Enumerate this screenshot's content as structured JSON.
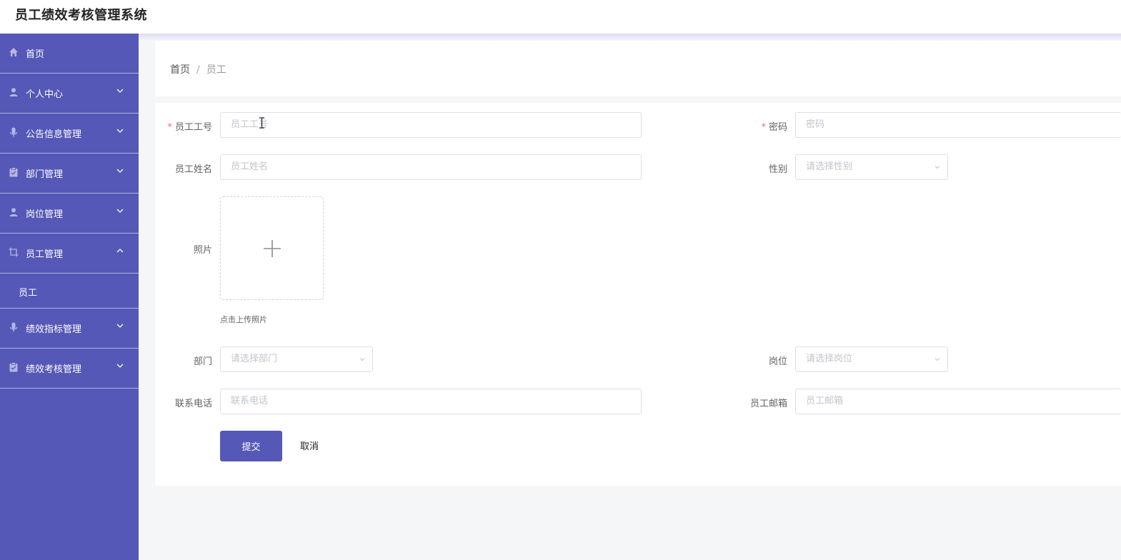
{
  "app": {
    "title": "员工绩效考核管理系统"
  },
  "sidebar": {
    "items": [
      {
        "label": "首页",
        "icon": "home-icon"
      },
      {
        "label": "个人中心",
        "icon": "user-icon"
      },
      {
        "label": "公告信息管理",
        "icon": "microphone-icon"
      },
      {
        "label": "部门管理",
        "icon": "clipboard-icon"
      },
      {
        "label": "岗位管理",
        "icon": "user-icon"
      },
      {
        "label": "员工管理",
        "icon": "crop-icon",
        "sub": [
          {
            "label": "员工"
          }
        ]
      },
      {
        "label": "绩效指标管理",
        "icon": "microphone-icon"
      },
      {
        "label": "绩效考核管理",
        "icon": "clipboard-icon"
      }
    ]
  },
  "breadcrumb": {
    "home": "首页",
    "sep": "/",
    "current": "员工"
  },
  "form": {
    "fields": {
      "emp_no": {
        "label": "员工工号",
        "placeholder": "员工工号",
        "required": true
      },
      "password": {
        "label": "密码",
        "placeholder": "密码",
        "required": true
      },
      "emp_name": {
        "label": "员工姓名",
        "placeholder": "员工姓名"
      },
      "gender": {
        "label": "性别",
        "placeholder": "请选择性别"
      },
      "photo": {
        "label": "照片",
        "hint": "点击上传照片"
      },
      "department": {
        "label": "部门",
        "placeholder": "请选择部门"
      },
      "position": {
        "label": "岗位",
        "placeholder": "请选择岗位"
      },
      "phone": {
        "label": "联系电话",
        "placeholder": "联系电话"
      },
      "email": {
        "label": "员工邮箱",
        "placeholder": "员工邮箱"
      }
    },
    "submit_label": "提交",
    "cancel_label": "取消",
    "required_mark": "*"
  },
  "colors": {
    "primary": "#5558b6",
    "required": "#f56c6c"
  }
}
